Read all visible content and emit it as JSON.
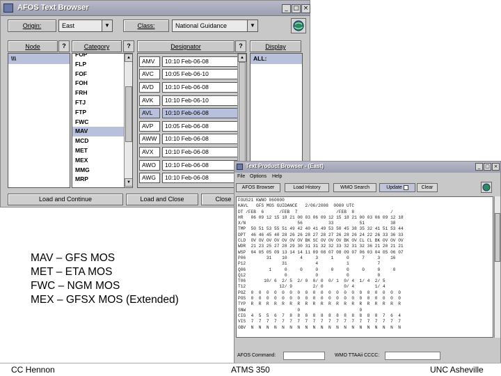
{
  "afos": {
    "title": "AFOS Text Browser",
    "window_controls": [
      "_",
      "□",
      "×"
    ],
    "origin_label": "Origin:",
    "origin_value": "East",
    "class_label": "Class:",
    "class_value": "National Guidance",
    "columns": {
      "node": "Node",
      "category": "Category",
      "designator": "Designator",
      "display": "Display",
      "help": "?"
    },
    "node_items": [
      "\\\\\\"
    ],
    "category_items": [
      "FOP",
      "FLP",
      "FOF",
      "FOH",
      "FRH",
      "FTJ",
      "FTP",
      "FWC",
      "MAV",
      "MCD",
      "MET",
      "MEX",
      "MMG",
      "MRP"
    ],
    "category_selected": "MAV",
    "designator_rows": [
      {
        "code": "AMV",
        "time": "10:10 Feb-06-08"
      },
      {
        "code": "AVC",
        "time": "10:05 Feb-06-10"
      },
      {
        "code": "AVD",
        "time": "10:10 Feb-06-08"
      },
      {
        "code": "AVK",
        "time": "10:10 Feb-06-10"
      },
      {
        "code": "AVL",
        "time": "10:10 Feb-06-08"
      },
      {
        "code": "AVP",
        "time": "10:05 Feb-06-08"
      },
      {
        "code": "AWW",
        "time": "10:10 Feb-06-08"
      },
      {
        "code": "AVX",
        "time": "10:10 Feb-06-08"
      },
      {
        "code": "AWO",
        "time": "10:10 Feb-06-08"
      },
      {
        "code": "AWG",
        "time": "10:10 Feb-06-08"
      }
    ],
    "designator_selected_index": 4,
    "display_items": [
      "ALL:"
    ],
    "buttons": {
      "load_continue": "Load and Continue",
      "load_close": "Load and Close",
      "close": "Close"
    }
  },
  "tpb": {
    "title": "Text Product Browser - (East)",
    "window_controls": [
      "_",
      "□",
      "×"
    ],
    "menu": [
      "File",
      "Options",
      "Help"
    ],
    "toolbar": {
      "afos_browser": "AFOS Browser",
      "load_history": "Load History",
      "wmo_search": "WMO Search",
      "update": "Update",
      "clear": "Clear"
    },
    "text_lines": [
      "FOUS21 KWNO 060000",
      "KAVL   GFS MOS GUIDANCE   2/06/2008  0000 UTC",
      "DT /FEB  6      /FEB  7               /FEB  8              /",
      "HR   06 09 12 15 18 21 00 03 06 09 12 15 18 21 00 03 06 09 12 18",
      "X/N                    56          33          51          38",
      "TMP  50 51 53 55 51 49 42 40 41 49 53 50 45 38 35 32 41 51 53 44",
      "DPT  46 46 45 40 28 26 26 28 27 28 27 26 28 26 24 22 26 33 36 33",
      "CLD  OV OV OV OV OV OV OV BK SC OV OV OV BK OV CL CL BK OV OV OV",
      "WDR  21 23 25 27 28 29 30 31 31 32 32 33 32 31 32 36 21 20 21 21",
      "WSP  04 05 05 09 13 14 14 11 09 08 07 08 09 07 06 03 04 05 06 07",
      "P06        31    10     4     3     1     0     7     3    16",
      "P12              31           4           1           7",
      "Q06         1     0     0     0     0     0     0     0     0",
      "Q12               0           0           0           0",
      "T06       10/ 6  2/ 5  2/ 0  0/ 0  0/ 1  0/ 4  1/ 4  2/ 5",
      "T12             12/ 9        2/ 0        0/ 4        1/ 4",
      "POZ  0  0  0  0  0  0  0  0  0  0  0  0  0  0  0  0  0  0  0  0",
      "POS  0  0  0  0  0  0  0  0  0  0  0  0  0  0  0  0  0  0  0  0",
      "TYP  R  R  R  R  R  R  R  R  R  R  R  R  R  R  R  R  R  R  R  R",
      "SNW                    0                       0",
      "CIG  4  5  5  6  7  8  8  8  8  8  8  8  8  8  8  8  8  7  6  4",
      "VIS  7  7  7  7  7  7  7  7  7  7  7  7  7  7  7  7  7  7  7  7",
      "OBV  N  N  N  N  N  N  N  N  N  N  N  N  N  N  N  N  N  N  N  N"
    ],
    "status": {
      "afos_command_label": "AFOS Command:",
      "wmo_label": "WMO TTAAii CCCC:"
    }
  },
  "legend": [
    "MAV – GFS MOS",
    "MET – ETA MOS",
    "FWC – NGM MOS",
    "MEX – GFSX MOS (Extended)"
  ],
  "footer": {
    "left": "CC Hennon",
    "center": "ATMS 350",
    "right": "UNC Asheville"
  }
}
